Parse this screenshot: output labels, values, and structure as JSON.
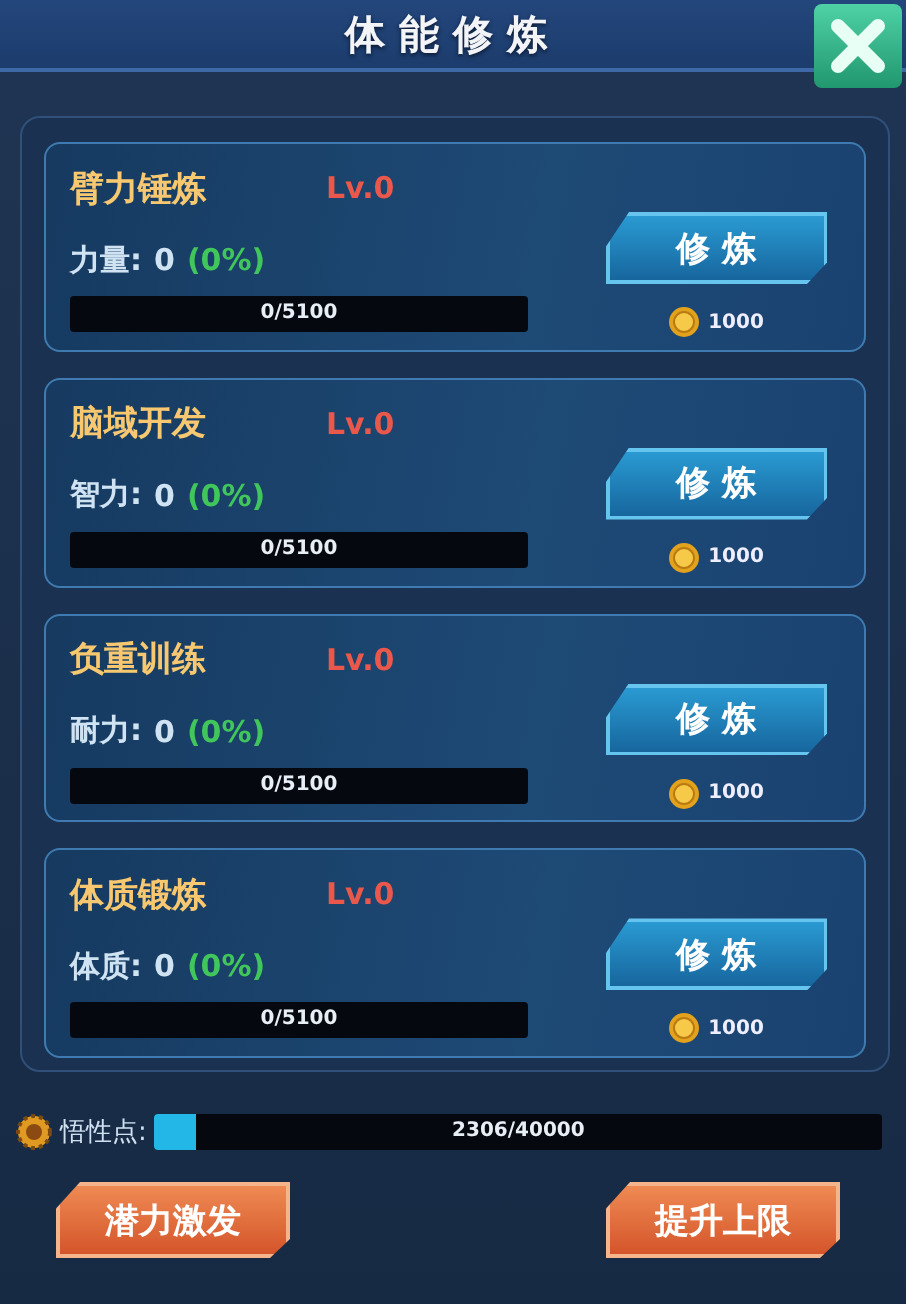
{
  "window": {
    "title": "体能修炼"
  },
  "trainings": [
    {
      "name": "臂力锤炼",
      "level_text": "Lv.0",
      "stat_label": "力量:",
      "stat_value": "0",
      "stat_percent": "(0%)",
      "progress": "0/5100",
      "button": "修 炼",
      "cost": "1000"
    },
    {
      "name": "脑域开发",
      "level_text": "Lv.0",
      "stat_label": "智力:",
      "stat_value": "0",
      "stat_percent": "(0%)",
      "progress": "0/5100",
      "button": "修 炼",
      "cost": "1000"
    },
    {
      "name": "负重训练",
      "level_text": "Lv.0",
      "stat_label": "耐力:",
      "stat_value": "0",
      "stat_percent": "(0%)",
      "progress": "0/5100",
      "button": "修 炼",
      "cost": "1000"
    },
    {
      "name": "体质锻炼",
      "level_text": "Lv.0",
      "stat_label": "体质:",
      "stat_value": "0",
      "stat_percent": "(0%)",
      "progress": "0/5100",
      "button": "修 炼",
      "cost": "1000"
    }
  ],
  "insight": {
    "label": "悟性点:",
    "progress": "2306/40000",
    "level": 0.058
  },
  "buttons": [
    "潜力激发",
    "提升上限"
  ]
}
